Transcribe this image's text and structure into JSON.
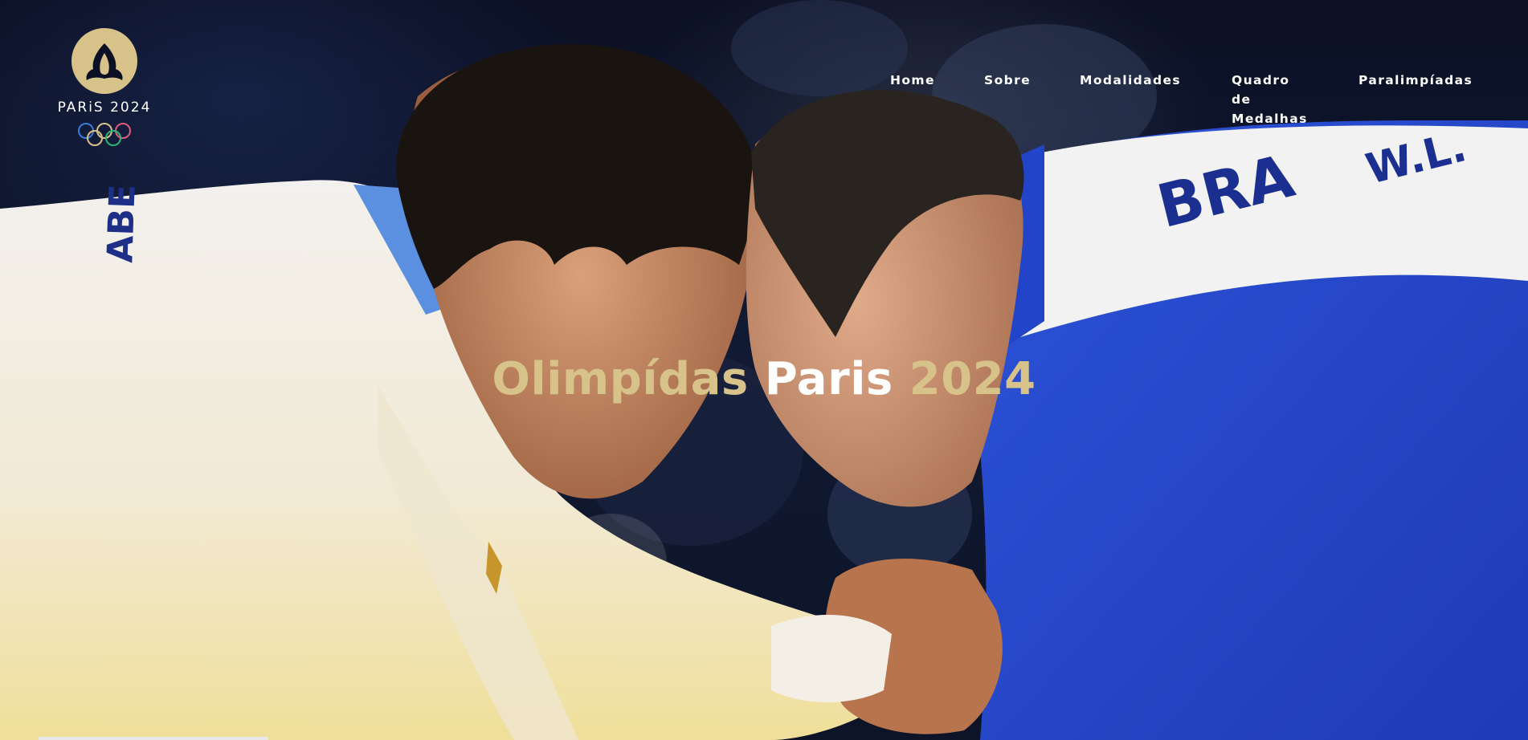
{
  "brand": {
    "wordmark": "PARiS 2024",
    "colors": {
      "gold": "#d7c28a",
      "rings": [
        "#3a7bd5",
        "#d7c28a",
        "#2bb673",
        "#d7c28a",
        "#e05a7a"
      ]
    }
  },
  "nav": {
    "items": [
      {
        "label": "Home"
      },
      {
        "label": "Sobre"
      },
      {
        "label": "Modalidades"
      },
      {
        "label": "Quadro de Medalhas"
      },
      {
        "label": "Paralimpíadas"
      }
    ]
  },
  "hero": {
    "title_part1": "Olimpídas",
    "title_part2": "Paris",
    "title_part3": "2024",
    "image_subject": "judo-athletes-photo",
    "jersey_text_left": "ABE",
    "jersey_text_right": "BRA",
    "jersey_name_right": "W.L."
  }
}
